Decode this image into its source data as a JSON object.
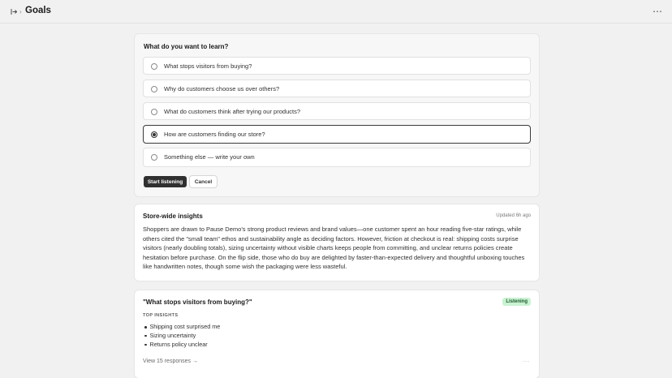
{
  "header": {
    "sidebar_toggle_icon": "sidebar-toggle-icon",
    "breadcrumb_sep": "›",
    "title": "Goals",
    "more_label": "⋯"
  },
  "question_card": {
    "title": "What do you want to learn?",
    "options": [
      {
        "label": "What stops visitors from buying?",
        "selected": false
      },
      {
        "label": "Why do customers choose us over others?",
        "selected": false
      },
      {
        "label": "What do customers think after trying our products?",
        "selected": false
      },
      {
        "label": "How are customers finding our store?",
        "selected": true
      },
      {
        "label": "Something else — write your own",
        "selected": false
      }
    ],
    "primary_button": "Start listening",
    "secondary_button": "Cancel"
  },
  "insights_card": {
    "title": "Store-wide insights",
    "updated": "Updated 6h ago",
    "summary": "Shoppers are drawn to Pause Demo's strong product reviews and brand values—one customer spent an hour reading five-star ratings, while others cited the \"small team\" ethos and sustainability angle as deciding factors. However, friction at checkout is real: shipping costs surprise visitors (nearly doubling totals), sizing uncertainty without visible charts keeps people from committing, and unclear returns policies create hesitation before purchase. On the flip side, those who do buy are delighted by faster-than-expected delivery and thoughtful unboxing touches like handwritten notes, though some wish the packaging were less wasteful."
  },
  "topic_card": {
    "title": "\"What stops visitors from buying?\"",
    "status": "Listening",
    "status_color": "#c9f2d2",
    "section_label": "TOP INSIGHTS",
    "insights": [
      "Shipping cost surprised me",
      "Sizing uncertainty",
      "Returns policy unclear"
    ],
    "view_link": "View 15 responses →",
    "more_label": "⋯"
  }
}
